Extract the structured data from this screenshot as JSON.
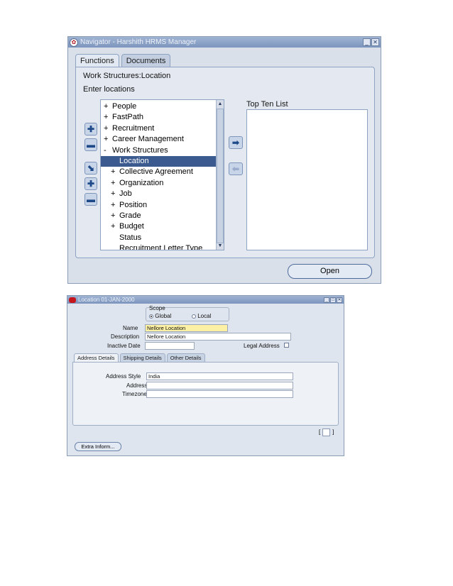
{
  "navigator": {
    "title": "Navigator - Harshith HRMS Manager",
    "tabs": [
      {
        "label": "Functions",
        "active": true
      },
      {
        "label": "Documents",
        "active": false
      }
    ],
    "breadcrumb": "Work Structures:Location",
    "instruction": "Enter locations",
    "tree": [
      {
        "prefix": "+",
        "label": "People",
        "indent": 0
      },
      {
        "prefix": "+",
        "label": "FastPath",
        "indent": 0
      },
      {
        "prefix": "+",
        "label": "Recruitment",
        "indent": 0
      },
      {
        "prefix": "+",
        "label": "Career Management",
        "indent": 0
      },
      {
        "prefix": "-",
        "label": "Work Structures",
        "indent": 0
      },
      {
        "prefix": "",
        "label": "Location",
        "indent": 1,
        "selected": true
      },
      {
        "prefix": "+",
        "label": "Collective Agreement",
        "indent": 1
      },
      {
        "prefix": "+",
        "label": "Organization",
        "indent": 1
      },
      {
        "prefix": "+",
        "label": "Job",
        "indent": 1
      },
      {
        "prefix": "+",
        "label": "Position",
        "indent": 1
      },
      {
        "prefix": "+",
        "label": "Grade",
        "indent": 1
      },
      {
        "prefix": "+",
        "label": "Budget",
        "indent": 1
      },
      {
        "prefix": "",
        "label": "Status",
        "indent": 1
      },
      {
        "prefix": "",
        "label": "Recruitment Letter Type",
        "indent": 1
      }
    ],
    "top_ten_label": "Top Ten List",
    "open_label": "Open"
  },
  "location": {
    "title": "Location 01-JAN-2000",
    "scope_label": "Scope",
    "scope_global": "Global",
    "scope_local": "Local",
    "name_label": "Name",
    "name_value": "Nellore Location",
    "description_label": "Description",
    "description_value": "Nellore Location",
    "inactive_date_label": "Inactive Date",
    "inactive_date_value": "",
    "legal_address_label": "Legal Address",
    "tabs": [
      {
        "label": "Address Details",
        "active": true
      },
      {
        "label": "Shipping Details",
        "active": false
      },
      {
        "label": "Other Details",
        "active": false
      }
    ],
    "address_style_label": "Address Style",
    "address_style_value": "India",
    "address_label": "Address",
    "address_value": "",
    "timezone_label": "Timezone",
    "timezone_value": "",
    "bracket_left": "[",
    "bracket_right": "]",
    "extra_info_label": "Extra Inform..."
  }
}
